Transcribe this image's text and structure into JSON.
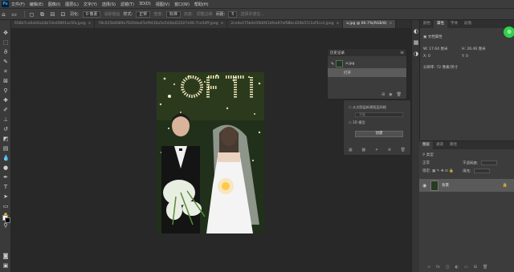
{
  "app": {
    "logo": "Ps"
  },
  "menu": [
    "文件(F)",
    "编辑(E)",
    "图像(I)",
    "图层(L)",
    "文字(Y)",
    "选择(S)",
    "滤镜(T)",
    "3D(D)",
    "视图(V)",
    "窗口(W)",
    "帮助(H)"
  ],
  "options": {
    "feather_label": "羽化:",
    "feather_value": "0 像素",
    "style_label": "样式:",
    "style_value": "正常",
    "width_label": "宽度:",
    "height_label": "高度:",
    "select_and_mask": "选择并遮住...",
    "antialias": "消除锯齿",
    "mode_value": "标准",
    "refine": "调整边缘",
    "spacing_label": "间距:",
    "spacing_value": "5"
  },
  "doc_tabs": [
    {
      "label": "658b7ca0a04a2db7ded5891ac5fa.jpeg",
      "active": false
    },
    {
      "label": "78c025b4689e7620deaf1ef9436a5e5d2bd22027e46-7ce5dff.jpeg",
      "active": false
    },
    {
      "label": "2ce4e275b4e5fb6f41dfea97ef68bcd29b57c1ef5ccd.jpeg",
      "active": false
    },
    {
      "label": "a.jpg @ 66.7%(RGB/8)",
      "active": true
    }
  ],
  "history": {
    "title": "历史记录",
    "snapshot": "a.jpg",
    "open_step": "打开"
  },
  "panel3d": {
    "item1": "从文图层新建图层网格",
    "field1": "平面",
    "item2": "3D 模型",
    "create": "创建"
  },
  "properties": {
    "tabs": [
      "颜色",
      "属性",
      "字体",
      "段落"
    ],
    "doc_props": "文档属性",
    "width_label": "W:",
    "width_value": "17.64 厘米",
    "height_label": "H:",
    "height_value": "26.46 厘米",
    "x_label": "X:",
    "x_value": "0",
    "y_label": "Y:",
    "y_value": "0",
    "resolution": "分辨率: 72 像素/英寸"
  },
  "layers": {
    "tabs": [
      "图层",
      "通道",
      "路径"
    ],
    "filter_label": "类型",
    "blend": "正常",
    "opacity_label": "不透明度:",
    "lock_label": "锁定:",
    "fill_label": "填充:",
    "layer_name": "背景"
  },
  "icons": {
    "move": "move-icon",
    "marquee": "marquee-icon",
    "lasso": "lasso-icon",
    "crop": "crop-icon",
    "brush": "brush-icon",
    "text": "text-tool-icon",
    "hand": "hand-icon",
    "zoom": "zoom-icon"
  }
}
